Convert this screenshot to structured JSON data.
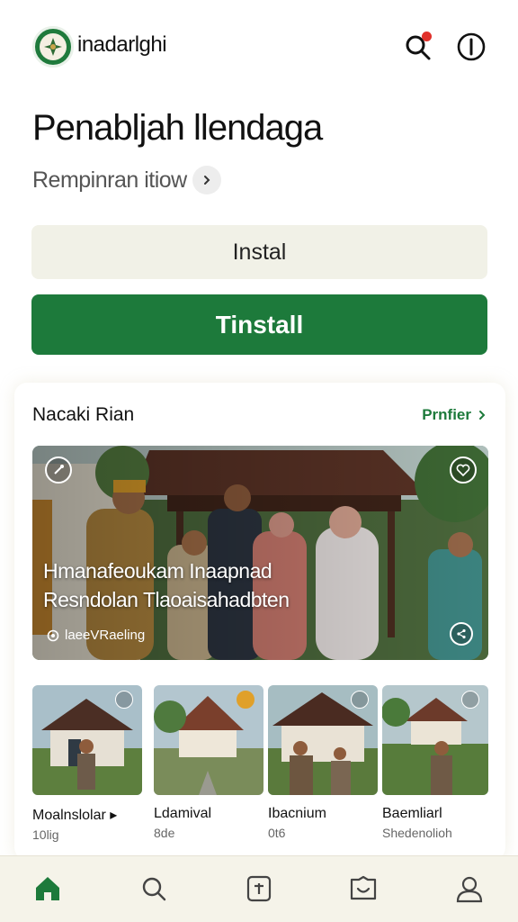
{
  "header": {
    "brand": "inadarlghi",
    "search_icon": "search-icon",
    "info_icon": "info-icon",
    "notification_color": "#e0312b"
  },
  "main": {
    "title": "Penabljah llendaga",
    "subtitle": "Rempinran itiow",
    "secondary_button": "Instal",
    "primary_button": "Tinstall"
  },
  "section": {
    "title": "Nacaki Rian",
    "more_link": "Prnfier",
    "hero": {
      "line1": "Hmanafeoukam Inaapnad",
      "line2": "Resndolan Tlaoaisahadbten",
      "meta": "laeeVRaeling"
    },
    "thumbs": [
      {
        "title": "Moalnslolar",
        "sub": "10lig",
        "has_arrow": true
      },
      {
        "title": "Ldamival",
        "sub": "8de"
      },
      {
        "title": "Ibacnium",
        "sub": "0t6"
      },
      {
        "title": "Baemliarl",
        "sub": "Shedenolioh"
      }
    ]
  },
  "nav": {
    "items": [
      "home-icon",
      "search-icon",
      "add-icon",
      "chat-icon",
      "profile-icon"
    ]
  },
  "colors": {
    "accent": "#1d7a3b",
    "secondary_bg": "#f1f1e7",
    "nav_bg": "#f5f3e9"
  }
}
